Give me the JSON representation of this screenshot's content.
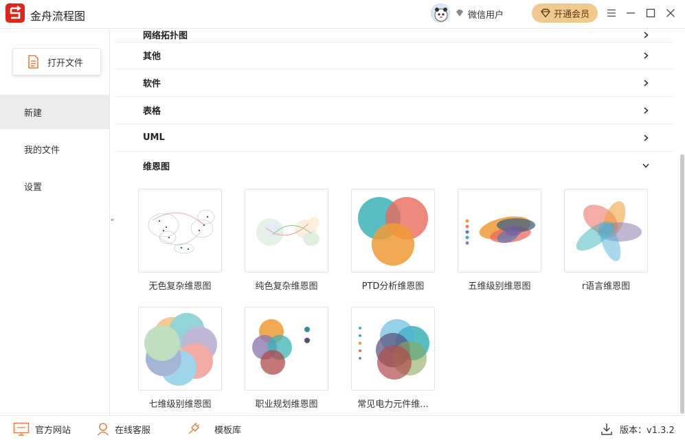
{
  "app": {
    "title": "金舟流程图"
  },
  "user": {
    "name": "微信用户",
    "vip_label": "开通会员"
  },
  "sidebar": {
    "open_file": "打开文件",
    "items": [
      {
        "label": "新建",
        "active": true
      },
      {
        "label": "我的文件",
        "active": false
      },
      {
        "label": "设置",
        "active": false
      }
    ]
  },
  "categories": {
    "partial": "网络拓扑图",
    "items": [
      "其他",
      "软件",
      "表格",
      "UML"
    ],
    "expanded": "维恩图"
  },
  "templates": [
    "无色复杂维恩图",
    "纯色复杂维恩图",
    "PTD分析维恩图",
    "五维级别维恩图",
    "r语言维恩图",
    "七维级别维恩图",
    "职业规划维恩图",
    "常见电力元件维..."
  ],
  "footer": {
    "website": "官方网站",
    "support": "在线客服",
    "templates": "模板库",
    "version_label": "版本：",
    "version": "v1.3.2"
  },
  "colors": {
    "brand": "#e0251b",
    "vip": "#f1c98f",
    "active_nav": "#ececec"
  }
}
